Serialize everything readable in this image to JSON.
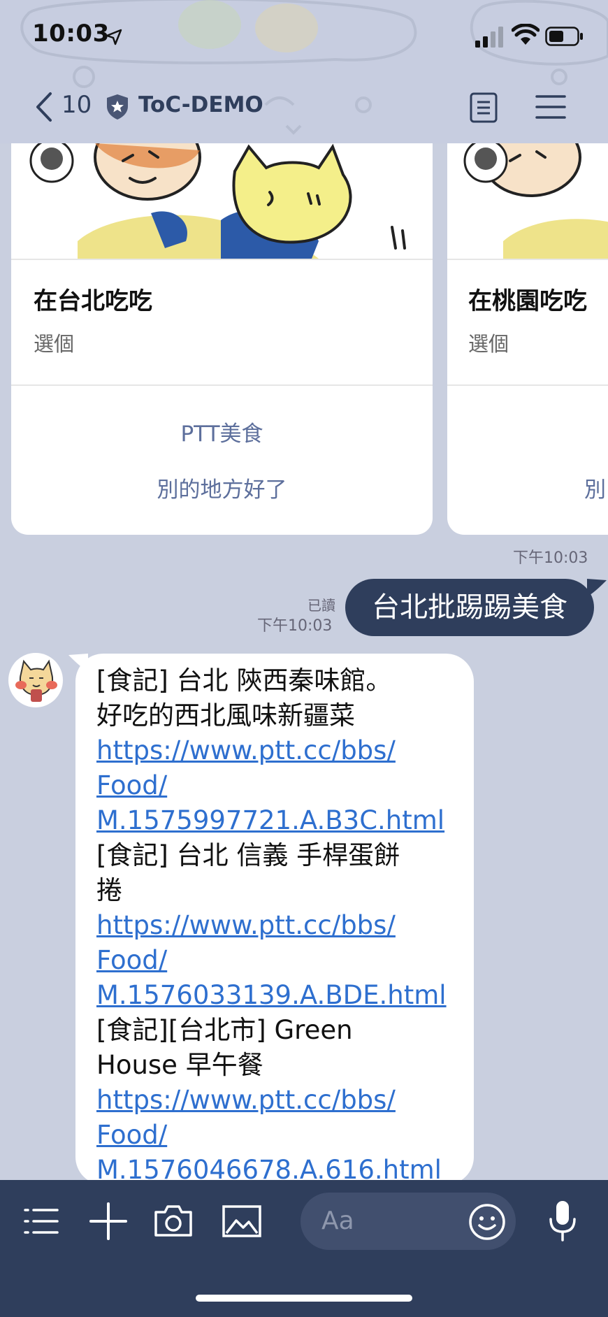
{
  "status_bar": {
    "time": "10:03"
  },
  "nav": {
    "back_count": "10",
    "title": "ToC-DEMO"
  },
  "carousel": {
    "cards": [
      {
        "title": "在台北吃吃",
        "subtitle": "選個",
        "actions": [
          "PTT美食",
          "別的地方好了"
        ]
      },
      {
        "title": "在桃園吃吃",
        "subtitle": "選個",
        "actions": [
          "別"
        ]
      }
    ],
    "timestamp": "下午10:03"
  },
  "sent_message": {
    "text": "台北批踢踢美食",
    "read_label": "已讀",
    "timestamp": "下午10:03"
  },
  "bot_message": {
    "lines": [
      {
        "text": "[食記] 台北 陝西秦味館。",
        "link": false
      },
      {
        "text": "好吃的西北風味新疆菜",
        "link": false
      },
      {
        "text": "https://www.ptt.cc/bbs/",
        "link": true
      },
      {
        "text": "Food/",
        "link": true
      },
      {
        "text": "M.1575997721.A.B3C.html",
        "link": true
      },
      {
        "text": "[食記] 台北 信義 手桿蛋餅",
        "link": false
      },
      {
        "text": "捲",
        "link": false
      },
      {
        "text": "https://www.ptt.cc/bbs/",
        "link": true
      },
      {
        "text": "Food/",
        "link": true
      },
      {
        "text": "M.1576033139.A.BDE.html",
        "link": true
      },
      {
        "text": "[食記][台北市] Green",
        "link": false
      },
      {
        "text": "House 早午餐",
        "link": false
      },
      {
        "text": "https://www.ptt.cc/bbs/",
        "link": true
      },
      {
        "text": "Food/",
        "link": true
      },
      {
        "text": "M.1576046678.A.616.html",
        "link": true
      }
    ]
  },
  "input_bar": {
    "placeholder": "Aa"
  },
  "colors": {
    "navy": "#2f3e5c",
    "link": "#2e6fcf",
    "background": "#c9cfdf"
  },
  "icons": [
    "location-arrow-icon",
    "signal-icon",
    "wifi-icon",
    "battery-icon",
    "back-chevron-icon",
    "shield-star-icon",
    "notes-icon",
    "menu-icon",
    "list-icon",
    "plus-icon",
    "camera-icon",
    "image-icon",
    "emoji-icon",
    "microphone-icon"
  ]
}
